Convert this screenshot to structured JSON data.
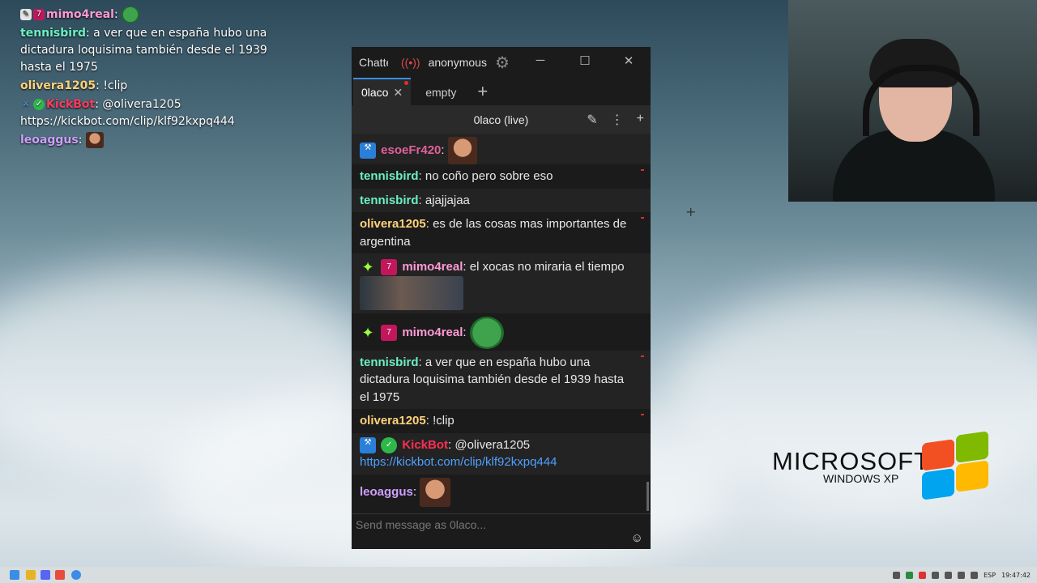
{
  "overlay": {
    "lines": [
      {
        "user": "mimo4real",
        "text": ":"
      },
      {
        "user": "tennisbird",
        "text": ": a ver que en españa hubo una dictadura loquisima también desde el 1939 hasta el 1975"
      },
      {
        "user": "olivera1205",
        "text": ": !clip"
      },
      {
        "user": "KickBot",
        "text": ": @olivera1205 https://kickbot.com/clip/klf92kxpq444"
      },
      {
        "user": "leoaggus",
        "text": ":"
      }
    ]
  },
  "window": {
    "app_title": "Chatterino",
    "account": "anonymous",
    "tabs": [
      {
        "label": "0laco",
        "active": true
      },
      {
        "label": "empty",
        "active": false
      }
    ],
    "channel_header": "0laco (live)",
    "input_placeholder": "Send message as 0laco...",
    "messages": [
      {
        "user": "esoeFr420",
        "text": ":"
      },
      {
        "user": "tennisbird",
        "text": ": no coño pero sobre eso"
      },
      {
        "user": "tennisbird",
        "text": ": ajajjajaa"
      },
      {
        "user": "olivera1205",
        "text": ": es de las cosas mas importantes de argentina"
      },
      {
        "user": "mimo4real",
        "text": ": el xocas no miraria el tiempo"
      },
      {
        "user": "mimo4real",
        "text": ":"
      },
      {
        "user": "tennisbird",
        "text": ": a ver que en españa hubo una dictadura loquisima también desde el 1939 hasta el 1975"
      },
      {
        "user": "olivera1205",
        "text": ": !clip"
      },
      {
        "user": "KickBot",
        "text": ": @olivera1205"
      },
      {
        "user": "",
        "text": "https://kickbot.com/clip/klf92kxpq444"
      },
      {
        "user": "leoaggus",
        "text": ":"
      }
    ]
  },
  "desktop": {
    "logo_main": "MICROSOFT",
    "logo_sub": "WINDOWS XP"
  },
  "taskbar": {
    "lang": "ESP",
    "time": "19:47:42"
  },
  "colors": {
    "accent_tab": "#3a8ee6",
    "link": "#4ea0ff",
    "name_green": "#6cf0c2",
    "name_yellow": "#ffd27a",
    "name_red": "#ff3b5c"
  }
}
